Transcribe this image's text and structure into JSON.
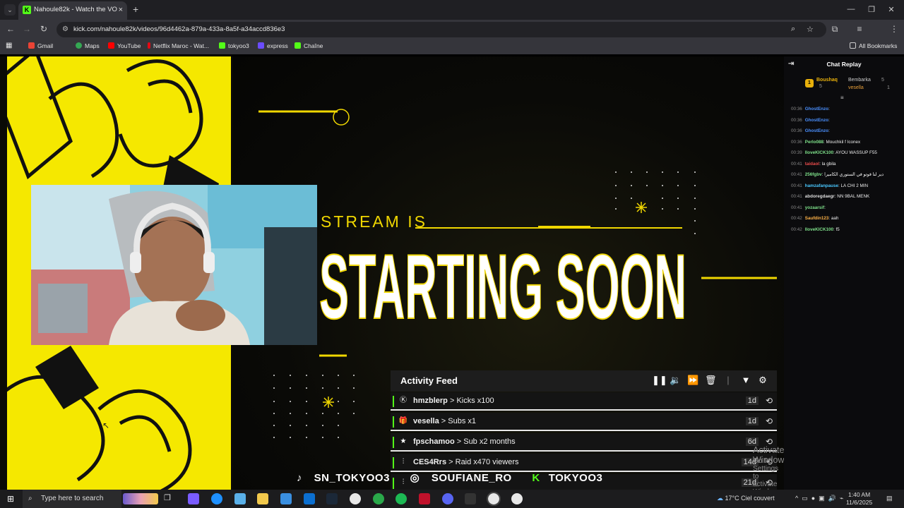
{
  "browser": {
    "tab_title": "Nahoule82k - Watch the VO",
    "url": "kick.com/nahoule82k/videos/96d4462a-879a-433a-8a5f-a34accd836e3",
    "bookmarks": [
      "Gmail",
      "Maps",
      "YouTube",
      "Netflix Maroc - Wat...",
      "tokyoo3",
      "express",
      "Chaîne"
    ],
    "all_bookmarks": "All Bookmarks",
    "accent": "#53fc18"
  },
  "overlay": {
    "subtitle": "STREAM IS",
    "title": "STARTING SOON",
    "activity_feed": {
      "title": "Activity Feed",
      "rows": [
        {
          "user": "hmzblerp",
          "action": "> Kicks x100",
          "age": "1d",
          "icon": "kick-icon"
        },
        {
          "user": "vesella",
          "action": "> Subs x1",
          "age": "1d",
          "icon": "gift-icon"
        },
        {
          "user": "fpschamoo",
          "action": "> Sub x2 months",
          "age": "6d",
          "icon": "star-icon"
        },
        {
          "user": "CES4Rrs",
          "action": "> Raid x470 viewers",
          "age": "14d",
          "icon": "raid-icon"
        },
        {
          "user": "",
          "action": "",
          "age": "21d",
          "icon": "raid-icon"
        }
      ]
    },
    "socials": [
      "SN_TOKYOO3",
      "SOUFIANE_RO",
      "TOKYOO3"
    ]
  },
  "windows_watermark": {
    "line1": "Activate Windows",
    "line2": "Go to Settings to activate Windows."
  },
  "chat": {
    "title": "Chat Replay",
    "pinned": {
      "first": {
        "rank": "1",
        "name": "Boushaq",
        "count": "5"
      },
      "second": {
        "name": "Bembarka",
        "count": "5"
      },
      "third": {
        "name": "vesella",
        "count": "1"
      }
    },
    "messages": [
      {
        "time": "00:36",
        "user": "GhostEnzo",
        "text": "",
        "color": "#4a90ff"
      },
      {
        "time": "00:36",
        "user": "GhostEnzo",
        "text": "",
        "color": "#4a90ff"
      },
      {
        "time": "00:36",
        "user": "GhostEnzo",
        "text": "",
        "color": "#4a90ff"
      },
      {
        "time": "00:36",
        "user": "Perlo088",
        "text": "Mouchkil f Iconex",
        "color": "#7ee08a"
      },
      {
        "time": "00:39",
        "user": "IloveKICK100",
        "text": "AYOU WASSUP F55",
        "color": "#7ee08a"
      },
      {
        "time": "00:41",
        "user": "taidaol",
        "text": "la gbila",
        "color": "#e84b4b"
      },
      {
        "time": "00:41",
        "user": "256fgbv",
        "text": "دير لنا فوتو في الستوري الكاميرا",
        "color": "#7ee08a"
      },
      {
        "time": "00:41",
        "user": "hamzafanpause",
        "text": "LA CHI 2 MIN",
        "color": "#4ac8ff"
      },
      {
        "time": "00:41",
        "user": "abdoregdaegr",
        "text": "NN 9BAL MENK",
        "color": "#dddddd"
      },
      {
        "time": "00:41",
        "user": "yozaarsif",
        "text": "",
        "color": "#7ee08a"
      },
      {
        "time": "00:42",
        "user": "Saufdin123",
        "text": "aah",
        "color": "#ffb347"
      },
      {
        "time": "00:42",
        "user": "IloveKICK100",
        "text": "f5",
        "color": "#7ee08a"
      }
    ]
  },
  "taskbar": {
    "search_placeholder": "Type here to search",
    "weather": "17°C  Ciel couvert",
    "time": "1:40 AM",
    "date": "11/6/2025"
  }
}
